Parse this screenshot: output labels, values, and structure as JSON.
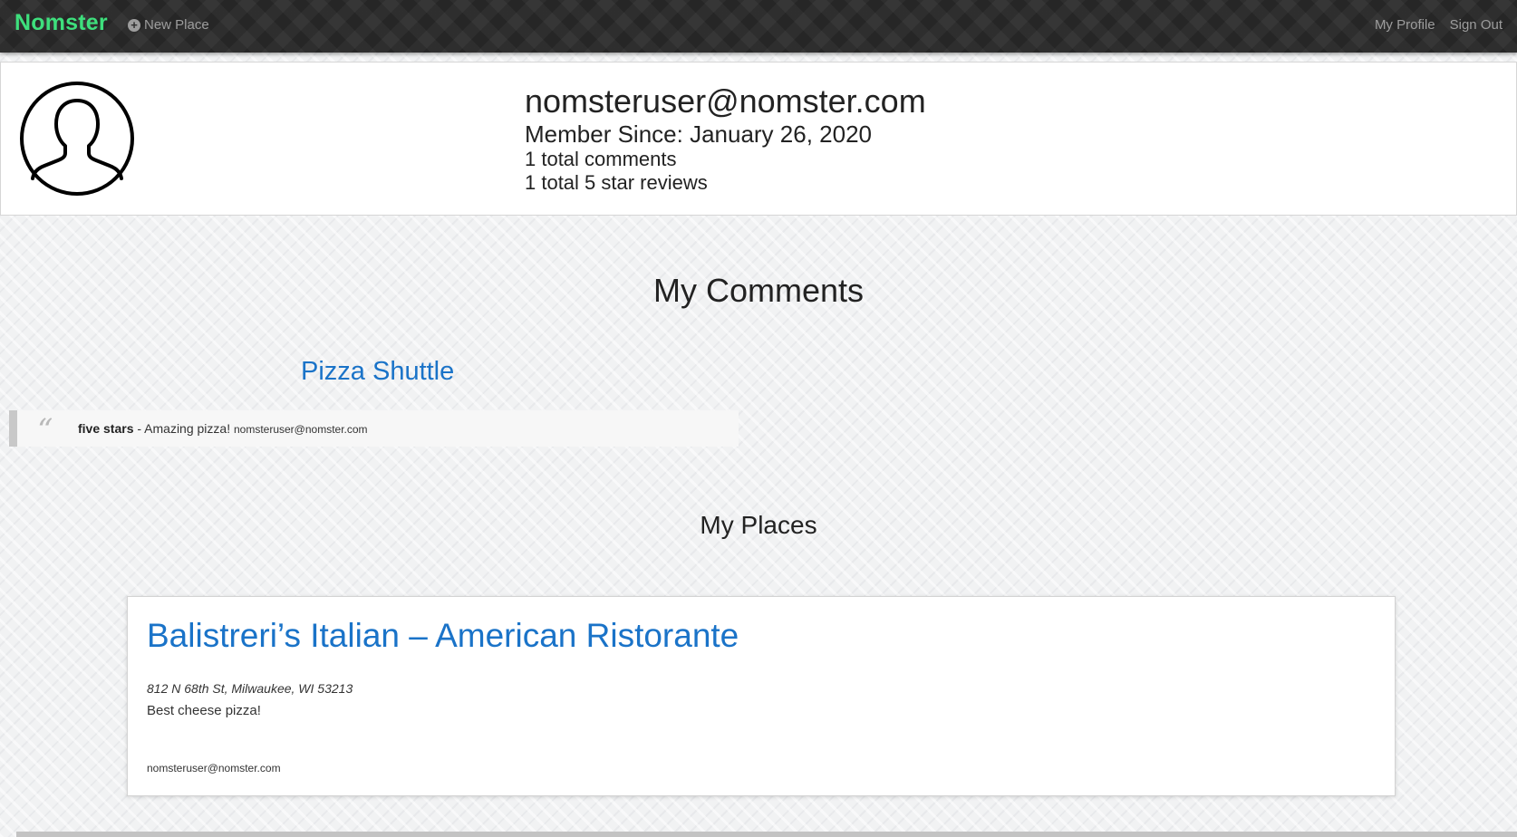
{
  "navbar": {
    "brand": "Nomster",
    "new_place_label": "New Place",
    "my_profile_label": "My Profile",
    "sign_out_label": "Sign Out",
    "brand_color": "#3ee07d"
  },
  "profile": {
    "email": "nomsteruser@nomster.com",
    "member_since": "Member Since: January 26, 2020",
    "total_comments": "1 total comments",
    "total_five_star": "1 total 5 star reviews",
    "avatar_icon": "user-silhouette-icon"
  },
  "comments_section": {
    "heading": "My Comments",
    "items": [
      {
        "place_name": "Pizza Shuttle",
        "quote_icon": "quote-icon",
        "rating": "five stars",
        "separator": " - ",
        "message": "Amazing pizza!",
        "author": "nomsteruser@nomster.com"
      }
    ]
  },
  "places_section": {
    "heading": "My Places",
    "items": [
      {
        "name": "Balistreri’s Italian – American Ristorante",
        "address": "812 N 68th St, Milwaukee, WI 53213",
        "description": "Best cheese pizza!",
        "owner": "nomsteruser@nomster.com"
      }
    ]
  },
  "colors": {
    "link": "#1a73c8",
    "navbar_bg": "#2e2e2e",
    "page_bg": "#f1f2f3"
  }
}
